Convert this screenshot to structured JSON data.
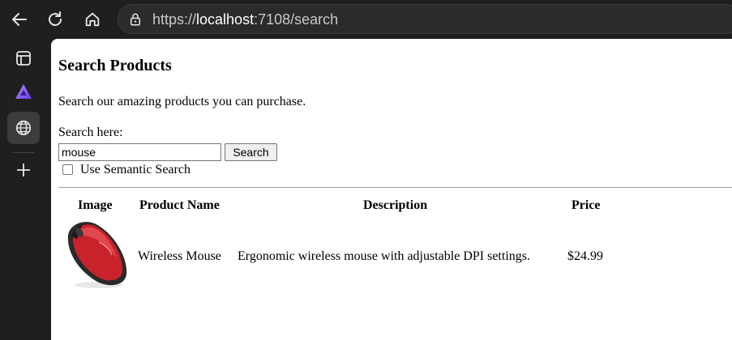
{
  "browser": {
    "url_prefix": "https://",
    "url_host": "localhost",
    "url_rest": ":7108/search",
    "icons": [
      "back-arrow-icon",
      "reload-icon",
      "home-icon",
      "lock-icon"
    ]
  },
  "sidebar": {
    "icons": [
      "tab-panel-icon",
      "triangle-app-icon",
      "globe-icon",
      "plus-icon"
    ]
  },
  "page": {
    "title": "Search Products",
    "description": "Search our amazing products you can purchase.",
    "search_label": "Search here:",
    "search_value": "mouse",
    "search_button": "Search",
    "semantic_label": "Use Semantic Search",
    "semantic_checked": false,
    "table": {
      "headers": [
        "Image",
        "Product Name",
        "Description",
        "Price"
      ],
      "rows": [
        {
          "image": "red-wireless-mouse",
          "name": "Wireless Mouse",
          "description": "Ergonomic wireless mouse with adjustable DPI settings.",
          "price": "$24.99"
        }
      ]
    }
  }
}
